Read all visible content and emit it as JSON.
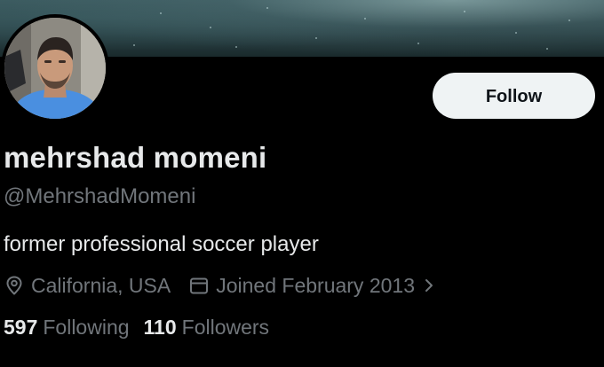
{
  "profile": {
    "display_name": "mehrshad momeni",
    "handle": "@MehrshadMomeni",
    "bio": "former professional soccer player",
    "location": "California, USA",
    "joined": "Joined February 2013",
    "follow_label": "Follow",
    "following_count": "597",
    "following_label": "Following",
    "followers_count": "110",
    "followers_label": "Followers"
  },
  "icons": {
    "location": "location-pin-icon",
    "joined": "calendar-icon",
    "chevron": "chevron-right-icon"
  },
  "colors": {
    "background": "#000000",
    "primary_text": "#e7e9ea",
    "secondary_text": "#71767b",
    "follow_button_bg": "#eff3f4",
    "follow_button_text": "#0f1419"
  }
}
